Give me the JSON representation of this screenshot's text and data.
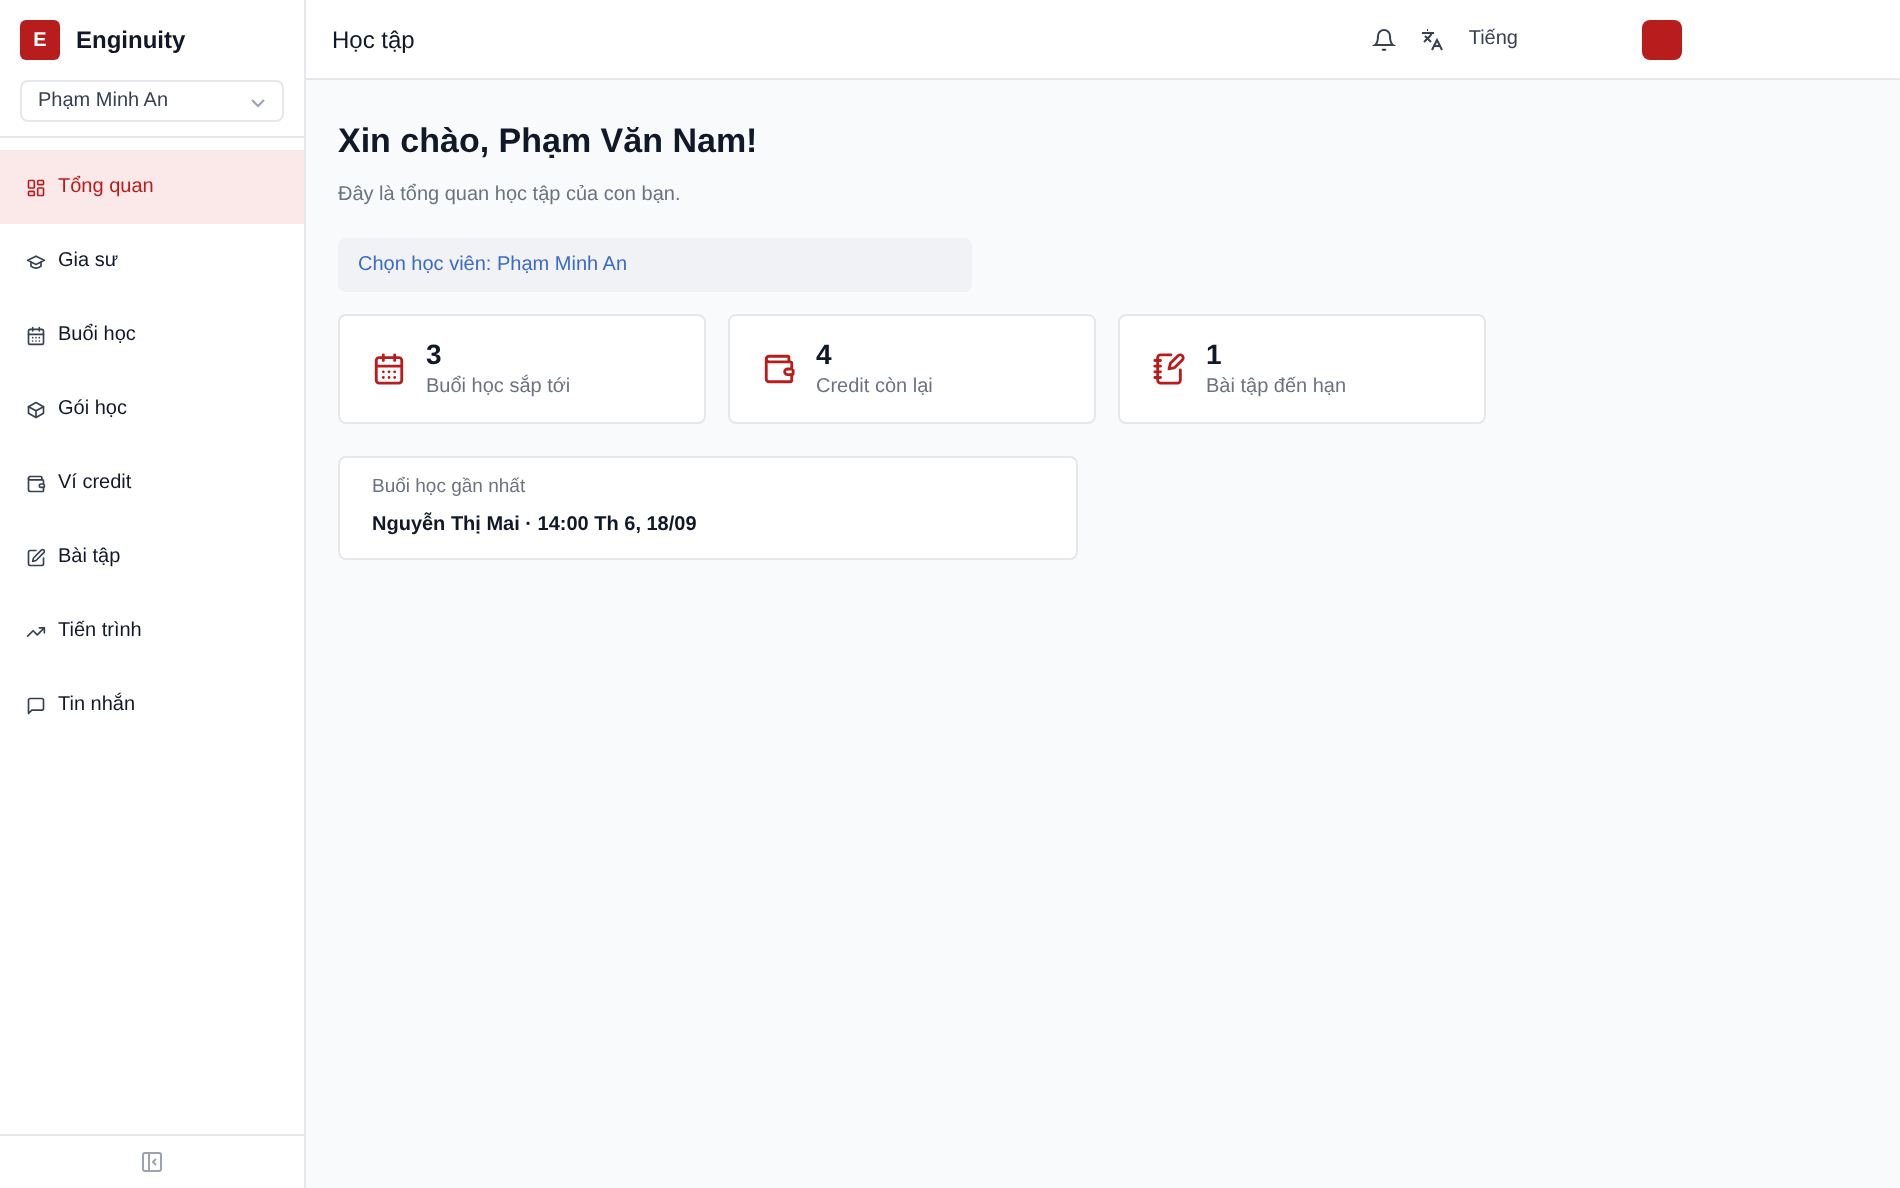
{
  "brand": {
    "logo_letter": "E",
    "name": "Enginuity"
  },
  "student_select": {
    "value": "Phạm Minh An"
  },
  "nav": [
    {
      "label": "Tổng quan",
      "selected": true
    },
    {
      "label": "Gia sư",
      "selected": false
    },
    {
      "label": "Buổi học",
      "selected": false
    },
    {
      "label": "Gói học",
      "selected": false
    },
    {
      "label": "Ví credit",
      "selected": false
    },
    {
      "label": "Bài tập",
      "selected": false
    },
    {
      "label": "Tiến trình",
      "selected": false
    },
    {
      "label": "Tin nhắn",
      "selected": false
    }
  ],
  "header": {
    "title": "Học tập",
    "language": "Tiếng"
  },
  "greeting": {
    "title": "Xin chào, Phạm Văn Nam!",
    "subtitle": "Đây là tổng quan học tập của con bạn."
  },
  "selected_student": "Chọn học viên: Phạm Minh An",
  "stats": [
    {
      "value": "3",
      "label": "Buổi học sắp tới"
    },
    {
      "value": "4",
      "label": "Credit còn lại"
    },
    {
      "value": "1",
      "label": "Bài tập đến hạn"
    }
  ],
  "next_session": {
    "label": "Buổi học gần nhất",
    "detail": "Nguyễn Thị Mai · 14:00 Th 6, 18/09"
  }
}
